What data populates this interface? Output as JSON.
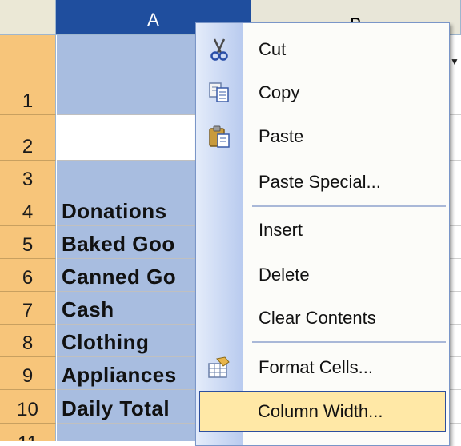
{
  "columns": [
    {
      "letter": "A",
      "selected": true
    },
    {
      "letter": "B",
      "selected": false
    }
  ],
  "rows": [
    {
      "num": "1",
      "text": ""
    },
    {
      "num": "2",
      "text": ""
    },
    {
      "num": "3",
      "text": ""
    },
    {
      "num": "4",
      "text": "Donations"
    },
    {
      "num": "5",
      "text": "Baked Goo"
    },
    {
      "num": "6",
      "text": "Canned Go"
    },
    {
      "num": "7",
      "text": "Cash"
    },
    {
      "num": "8",
      "text": "Clothing"
    },
    {
      "num": "9",
      "text": "Appliances"
    },
    {
      "num": "10",
      "text": "Daily Total"
    },
    {
      "num": "11",
      "text": ""
    }
  ],
  "context_menu": {
    "items": [
      {
        "label": "Cut",
        "icon": "scissors-icon"
      },
      {
        "label": "Copy",
        "icon": "copy-icon"
      },
      {
        "label": "Paste",
        "icon": "paste-icon"
      },
      {
        "label": "Paste Special...",
        "icon": ""
      },
      {
        "label": "Insert",
        "icon": ""
      },
      {
        "label": "Delete",
        "icon": ""
      },
      {
        "label": "Clear Contents",
        "icon": ""
      },
      {
        "label": "Format Cells...",
        "icon": "format-cells-icon"
      },
      {
        "label": "Column Width...",
        "icon": "",
        "highlighted": true
      }
    ]
  },
  "colors": {
    "selected_header": "#1f4e9e",
    "row_header": "#f7c57a",
    "selected_cells": "#a8bde0",
    "menu_highlight": "#ffe8a6"
  }
}
